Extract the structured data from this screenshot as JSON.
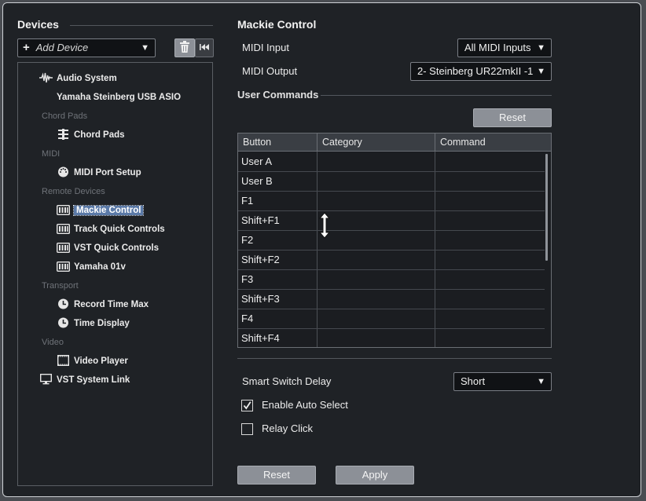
{
  "devices_panel": {
    "title": "Devices",
    "add_device_label": "Add Device",
    "tree": [
      {
        "type": "item",
        "label": "Audio System",
        "icon": "waveform-icon",
        "indent": 1
      },
      {
        "type": "item",
        "label": "Yamaha Steinberg USB ASIO",
        "icon": "",
        "indent": 2
      },
      {
        "type": "category",
        "label": "Chord Pads"
      },
      {
        "type": "item",
        "label": "Chord Pads",
        "icon": "sliders-icon",
        "indent": 2
      },
      {
        "type": "category",
        "label": "MIDI"
      },
      {
        "type": "item",
        "label": "MIDI Port Setup",
        "icon": "midi-port-icon",
        "indent": 2
      },
      {
        "type": "category",
        "label": "Remote Devices"
      },
      {
        "type": "item",
        "label": "Mackie Control",
        "icon": "remote-device-icon",
        "indent": 2,
        "selected": true
      },
      {
        "type": "item",
        "label": "Track Quick Controls",
        "icon": "remote-device-icon",
        "indent": 2
      },
      {
        "type": "item",
        "label": "VST Quick Controls",
        "icon": "remote-device-icon",
        "indent": 2
      },
      {
        "type": "item",
        "label": "Yamaha 01v",
        "icon": "remote-device-icon",
        "indent": 2
      },
      {
        "type": "category",
        "label": "Transport"
      },
      {
        "type": "item",
        "label": "Record Time Max",
        "icon": "clock-icon",
        "indent": 2
      },
      {
        "type": "item",
        "label": "Time Display",
        "icon": "clock-icon",
        "indent": 2
      },
      {
        "type": "category",
        "label": "Video"
      },
      {
        "type": "item",
        "label": "Video Player",
        "icon": "film-icon",
        "indent": 2
      },
      {
        "type": "item",
        "label": "VST System Link",
        "icon": "monitor-icon",
        "indent": 1
      }
    ]
  },
  "settings": {
    "title": "Mackie Control",
    "midi_input_label": "MIDI Input",
    "midi_input_value": "All MIDI Inputs",
    "midi_output_label": "MIDI Output",
    "midi_output_value": "2- Steinberg UR22mkII -1",
    "user_commands_title": "User Commands",
    "reset_label": "Reset",
    "table": {
      "columns": [
        "Button",
        "Category",
        "Command"
      ],
      "rows": [
        [
          "User A",
          "",
          ""
        ],
        [
          "User B",
          "",
          ""
        ],
        [
          "F1",
          "",
          ""
        ],
        [
          "Shift+F1",
          "",
          ""
        ],
        [
          "F2",
          "",
          ""
        ],
        [
          "Shift+F2",
          "",
          ""
        ],
        [
          "F3",
          "",
          ""
        ],
        [
          "Shift+F3",
          "",
          ""
        ],
        [
          "F4",
          "",
          ""
        ],
        [
          "Shift+F4",
          "",
          ""
        ]
      ]
    },
    "smart_switch_delay_label": "Smart Switch Delay",
    "smart_switch_delay_value": "Short",
    "enable_auto_select_label": "Enable Auto Select",
    "enable_auto_select_checked": true,
    "relay_click_label": "Relay Click",
    "relay_click_checked": false
  },
  "footer": {
    "reset_label": "Reset",
    "apply_label": "Apply"
  }
}
